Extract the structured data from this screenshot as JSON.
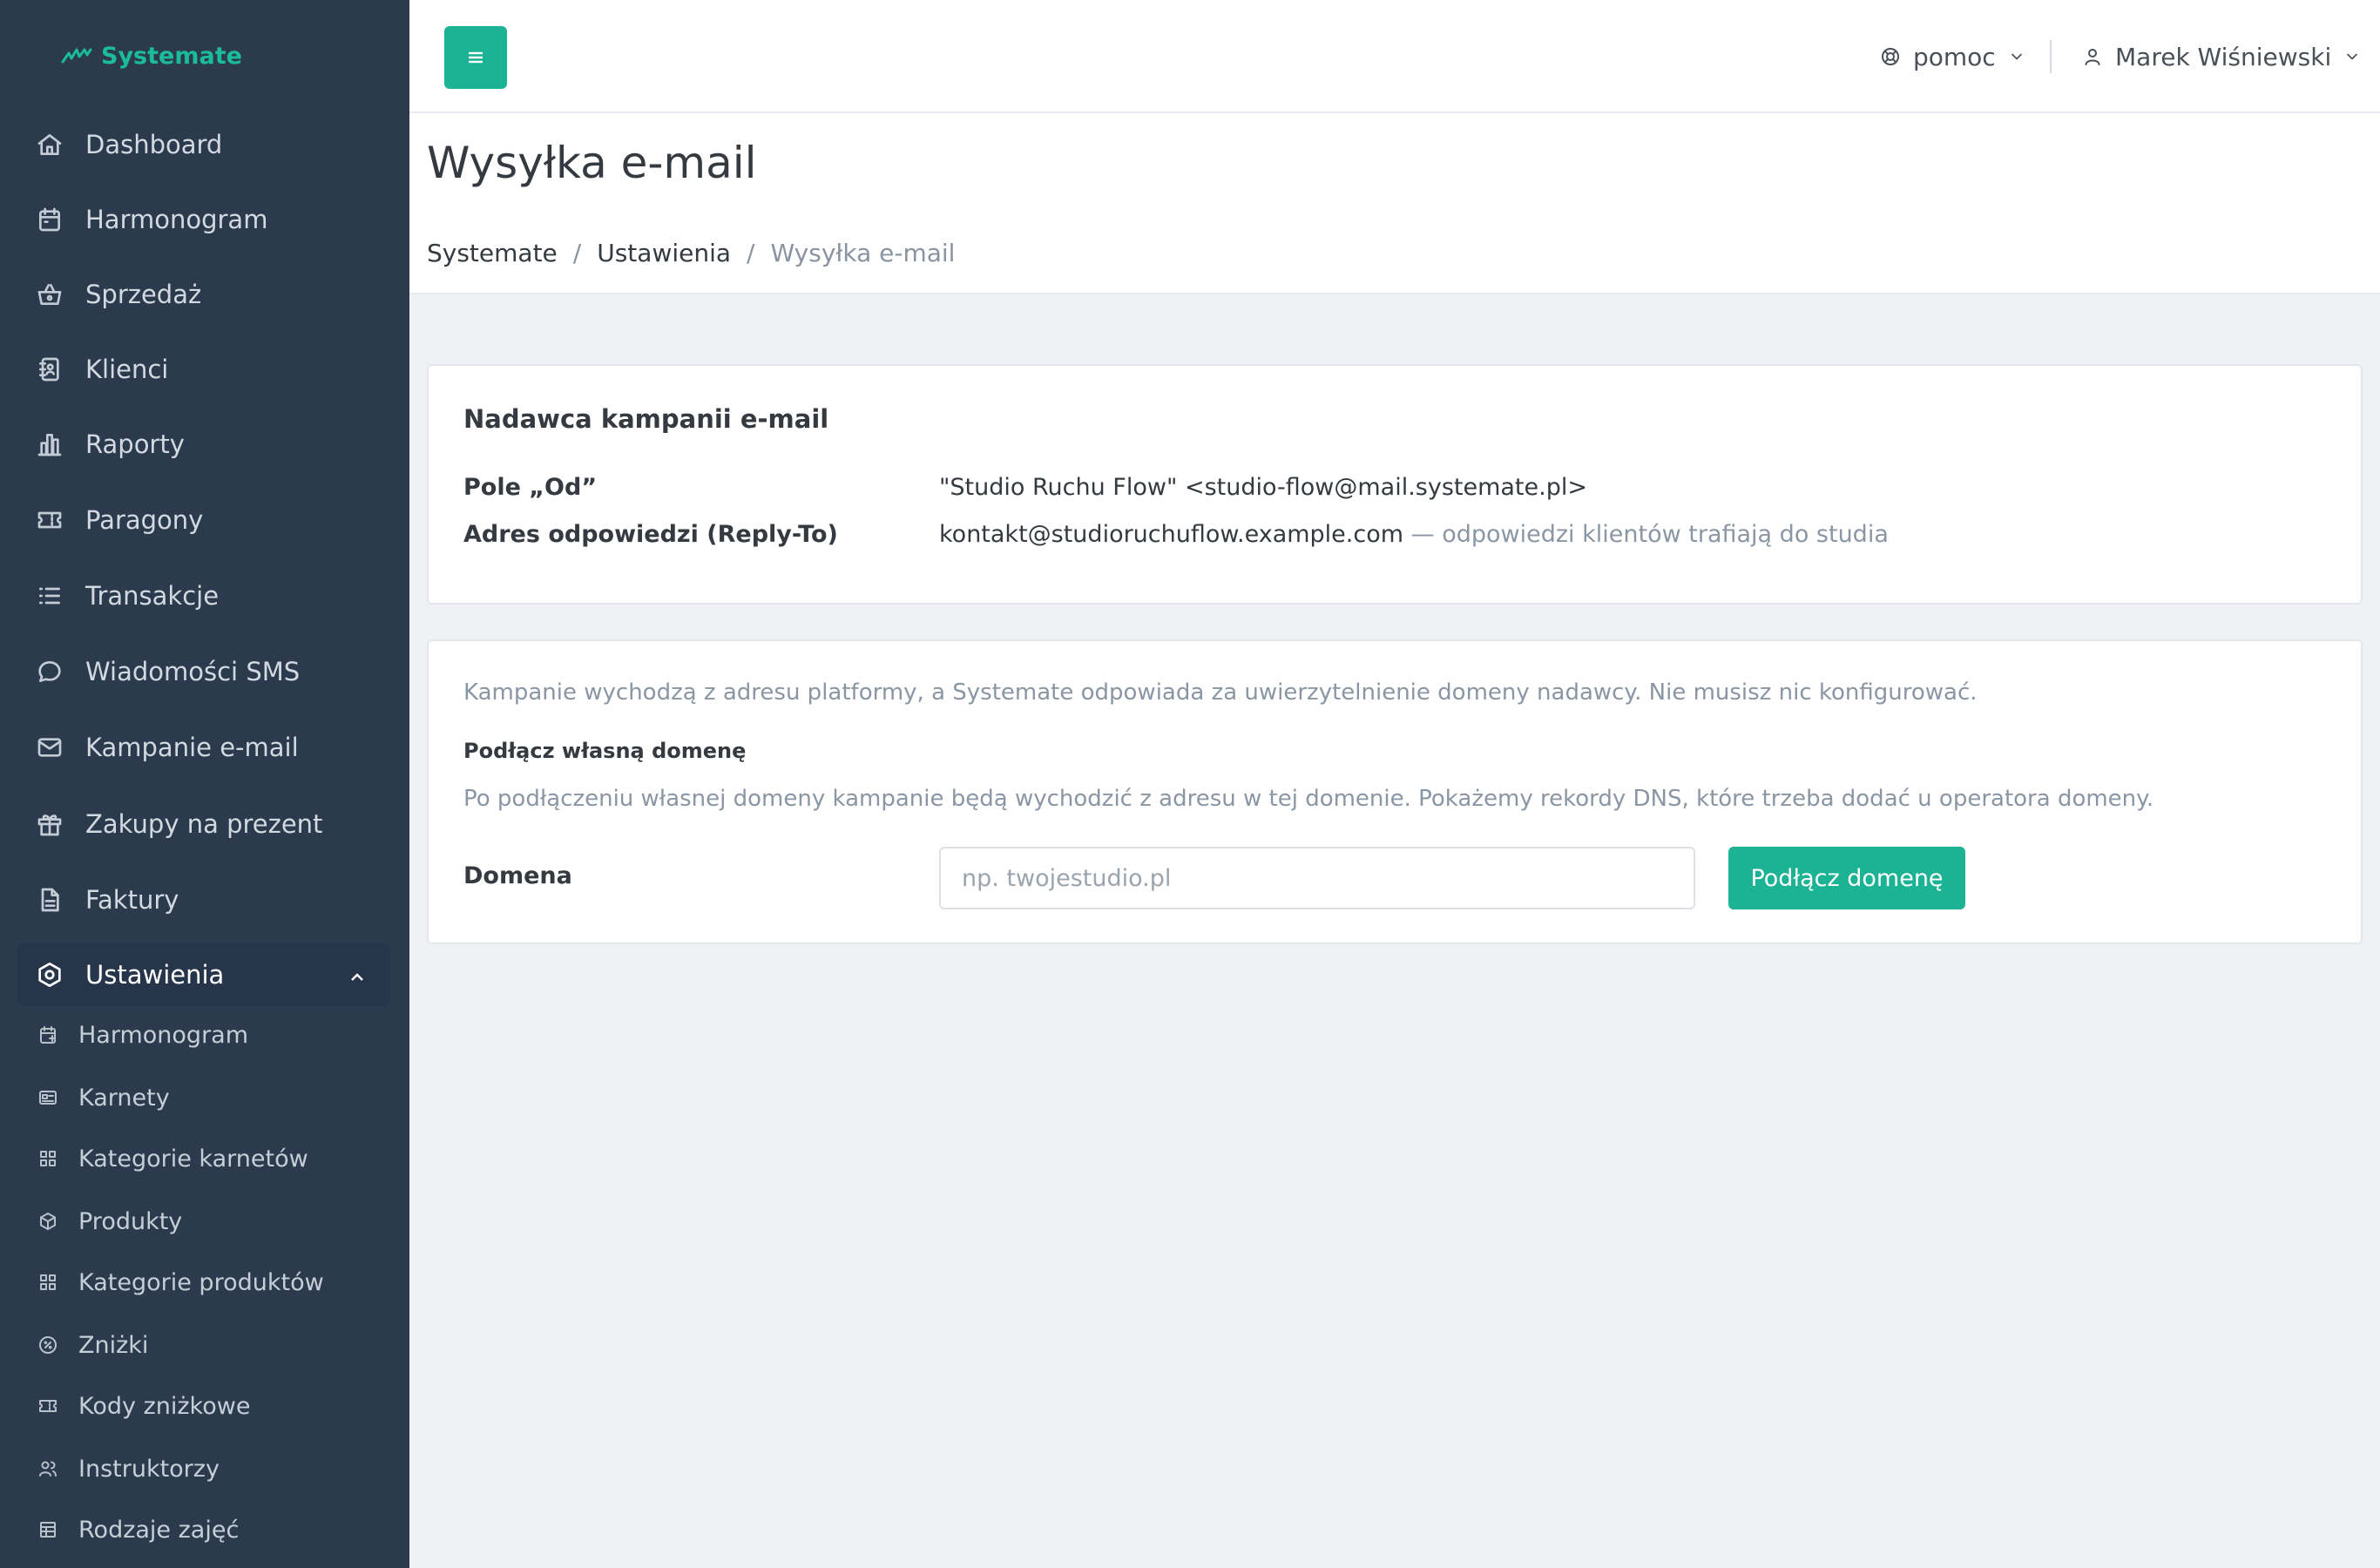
{
  "app": {
    "brand_name": "Systemate",
    "accent_color": "#1bb394",
    "sidebar_color": "#2b3b4d"
  },
  "sidebar": {
    "items": [
      {
        "label": "Dashboard",
        "icon": "home-icon"
      },
      {
        "label": "Harmonogram",
        "icon": "calendar-icon"
      },
      {
        "label": "Sprzedaż",
        "icon": "basket-icon"
      },
      {
        "label": "Klienci",
        "icon": "contacts-icon"
      },
      {
        "label": "Raporty",
        "icon": "bar-chart-icon"
      },
      {
        "label": "Paragony",
        "icon": "ticket-icon"
      },
      {
        "label": "Transakcje",
        "icon": "list-icon"
      },
      {
        "label": "Wiadomości SMS",
        "icon": "chat-icon"
      },
      {
        "label": "Kampanie e-mail",
        "icon": "mail-icon"
      },
      {
        "label": "Zakupy na prezent",
        "icon": "gift-icon"
      },
      {
        "label": "Faktury",
        "icon": "document-icon"
      },
      {
        "label": "Ustawienia",
        "icon": "settings-icon",
        "expanded": true
      }
    ],
    "subitems": [
      {
        "label": "Harmonogram",
        "icon": "calendar-icon"
      },
      {
        "label": "Karnety",
        "icon": "card-icon"
      },
      {
        "label": "Kategorie karnetów",
        "icon": "grid-icon"
      },
      {
        "label": "Produkty",
        "icon": "box-icon"
      },
      {
        "label": "Kategorie produktów",
        "icon": "grid-icon"
      },
      {
        "label": "Zniżki",
        "icon": "percent-icon"
      },
      {
        "label": "Kody zniżkowe",
        "icon": "ticket-icon"
      },
      {
        "label": "Instruktorzy",
        "icon": "users-icon"
      },
      {
        "label": "Rodzaje zajęć",
        "icon": "table-icon"
      }
    ]
  },
  "topbar": {
    "menu_icon": "hamburger-icon",
    "help_label": "pomoc",
    "help_icon": "lifebuoy-icon",
    "user_name": "Marek Wiśniewski",
    "user_icon": "user-icon"
  },
  "page": {
    "title": "Wysyłka e-mail",
    "breadcrumb": [
      "Systemate",
      "Ustawienia",
      "Wysyłka e-mail"
    ],
    "breadcrumb_separator": "/"
  },
  "sender_card": {
    "title": "Nadawca kampanii e-mail",
    "from_label": "Pole „Od”",
    "from_value": "\"Studio Ruchu Flow\" <studio-flow@mail.systemate.pl>",
    "reply_label": "Adres odpowiedzi (Reply-To)",
    "reply_value": "kontakt@studioruchuflow.example.com",
    "reply_note": "— odpowiedzi klientów trafiają do studia"
  },
  "domain_card": {
    "info_text": "Kampanie wychodzą z adresu platformy, a Systemate odpowiada za uwierzytelnienie domeny nadawcy. Nie musisz nic konfigurować.",
    "subtitle": "Podłącz własną domenę",
    "description": "Po podłączeniu własnej domeny kampanie będą wychodzić z adresu w tej domenie. Pokażemy rekordy DNS, które trzeba dodać u operatora domeny.",
    "domain_label": "Domena",
    "domain_value": "",
    "domain_placeholder": "np. twojestudio.pl",
    "connect_button": "Podłącz domenę"
  }
}
